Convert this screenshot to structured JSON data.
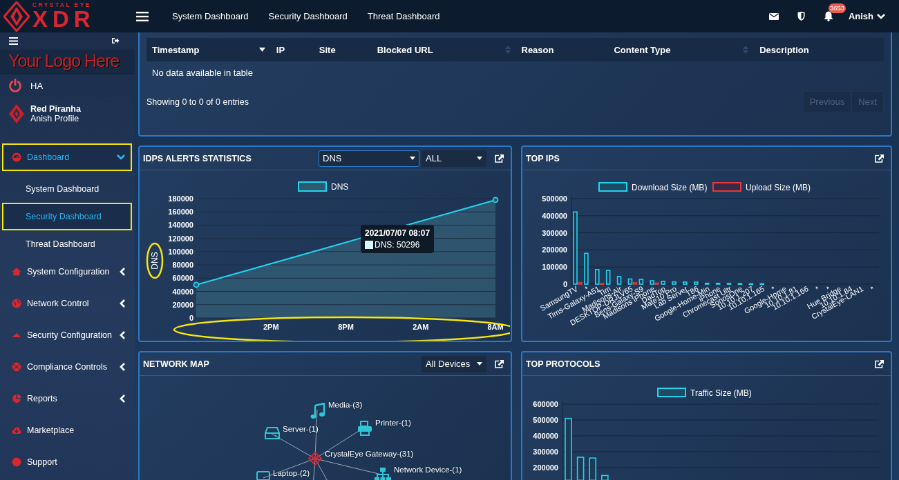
{
  "header": {
    "brand_top": "CRYSTAL EYE",
    "brand_main": "XDR",
    "nav": [
      {
        "label": "System Dashboard"
      },
      {
        "label": "Security Dashboard"
      },
      {
        "label": "Threat Dashboard"
      }
    ],
    "notifications": "3653",
    "user": "Anish"
  },
  "sidebar": {
    "logo_text": "Your Logo Here",
    "ha": "HA",
    "profile": {
      "name": "Red Piranha",
      "subtitle": "Anish Profile"
    },
    "menu": [
      {
        "label": "Dashboard",
        "kind": "group",
        "selected": true,
        "expanded": true,
        "highlighted": true,
        "children": [
          {
            "label": "System Dashboard",
            "selected": false,
            "highlighted": false
          },
          {
            "label": "Security Dashboard",
            "selected": true,
            "highlighted": true
          },
          {
            "label": "Threat Dashboard",
            "selected": false,
            "highlighted": false
          }
        ]
      },
      {
        "label": "System Configuration",
        "kind": "group",
        "selected": false,
        "expanded": false,
        "highlighted": false
      },
      {
        "label": "Network Control",
        "kind": "group",
        "selected": false,
        "expanded": false,
        "highlighted": false
      },
      {
        "label": "Security Configuration",
        "kind": "group",
        "selected": false,
        "expanded": false,
        "highlighted": false
      },
      {
        "label": "Compliance Controls",
        "kind": "group",
        "selected": false,
        "expanded": false,
        "highlighted": false
      },
      {
        "label": "Reports",
        "kind": "group",
        "selected": false,
        "expanded": false,
        "highlighted": false
      },
      {
        "label": "Marketplace",
        "kind": "link",
        "selected": false,
        "highlighted": false
      },
      {
        "label": "Support",
        "kind": "link",
        "selected": false,
        "highlighted": false
      }
    ]
  },
  "table": {
    "columns": [
      {
        "label": "Timestamp",
        "sortable": true,
        "sorted": true
      },
      {
        "label": "IP"
      },
      {
        "label": "Site"
      },
      {
        "label": "Blocked URL",
        "sortable": true,
        "sorted": false
      },
      {
        "label": "Reason"
      },
      {
        "label": "Content Type",
        "sortable": true,
        "sorted": false
      },
      {
        "label": "Description"
      }
    ],
    "empty_message": "No data available in table",
    "info": "Showing 0 to 0 of 0 entries",
    "pager": [
      {
        "label": "Previous",
        "disabled": true
      },
      {
        "label": "Next",
        "disabled": true
      }
    ]
  },
  "panels": [
    {
      "kind": "line_chart",
      "title": "IDPS ALERTS STATISTICS",
      "dropdowns": [
        {
          "value": "DNS",
          "focused": true
        },
        {
          "value": "ALL",
          "focused": false
        }
      ],
      "highlights": {
        "y_axis_label": true,
        "x_axis": true
      },
      "tooltip": {
        "title": "2021/07/07 08:07",
        "text": "DNS: 50296"
      },
      "chart_data": {
        "type": "area",
        "ylabel": "DNS",
        "legend": "top",
        "grid": true,
        "categories": [
          null,
          "2PM",
          "8PM",
          "2AM",
          "8AM"
        ],
        "ylim": [
          0,
          180000
        ],
        "yticks": [
          0,
          20000,
          40000,
          60000,
          80000,
          100000,
          120000,
          140000,
          160000,
          180000
        ],
        "series": [
          {
            "name": "DNS",
            "color": "#22d3ee",
            "values": [
              50000,
              82000,
              114000,
              146000,
              178000
            ]
          }
        ]
      }
    },
    {
      "kind": "bar_chart",
      "title": "TOP IPS",
      "chart_data": {
        "type": "bar",
        "legend": "top",
        "grid": true,
        "categories": [
          "SamsungTV",
          "*",
          "Tims-Galaxy-A51",
          "Tim",
          "Madisons-Air",
          "DESKTOP-DRJLV65",
          "Bens-Galaxy-S9",
          "Madisons iPhone",
          "DadTop",
          "Mate10 Pro",
          "Lab Server",
          "T86",
          "Google-Home-Min",
          "iPhone",
          "Chromecast Ultr",
          "SonosOne",
          "10.10.1.207",
          "10.10.1.165",
          "*",
          "Google-Home",
          "10.10.1.81",
          "10.10.1.166",
          "*",
          "*",
          "Hue Bridge",
          "10.10.1.84",
          "CrystalEye-LAN1",
          "*"
        ],
        "ylim": [
          0,
          500000
        ],
        "yticks": [
          0,
          100000,
          200000,
          300000,
          400000,
          500000
        ],
        "series": [
          {
            "name": "Download Size (MB)",
            "color": "#22d3ee",
            "values": [
              422000,
              180000,
              85000,
              80000,
              45000,
              30000,
              28000,
              20000,
              16000,
              13000,
              12000,
              12000,
              5000,
              5000,
              4000,
              3000,
              2000,
              2000,
              0,
              0,
              0,
              0,
              0,
              0,
              0,
              0,
              0,
              0
            ]
          },
          {
            "name": "Upload Size (MB)",
            "color": "#e53935",
            "values": [
              8000,
              0,
              3000,
              0,
              0,
              8000,
              0,
              6000,
              0,
              0,
              0,
              0,
              0,
              0,
              0,
              0,
              0,
              0,
              0,
              0,
              0,
              0,
              0,
              0,
              0,
              0,
              0,
              0
            ]
          }
        ]
      }
    },
    {
      "kind": "network_map",
      "title": "NETWORK MAP",
      "dropdowns": [
        {
          "value": "All Devices",
          "focused": false
        }
      ],
      "map": {
        "center": {
          "label": "CrystalEye Gateway-(31)"
        },
        "nodes": [
          {
            "label": "Media-(3)",
            "kind": "media"
          },
          {
            "label": "Printer-(1)",
            "kind": "printer"
          },
          {
            "label": "Server-(1)",
            "kind": "server"
          },
          {
            "label": "Network Device-(1)",
            "kind": "network"
          },
          {
            "label": "Laptop-(2)",
            "kind": "laptop"
          }
        ]
      }
    },
    {
      "kind": "bar_chart",
      "title": "TOP PROTOCOLS",
      "chart_data": {
        "type": "bar",
        "legend": "top",
        "grid": true,
        "categories": [
          null,
          null,
          null,
          null,
          null,
          null,
          null,
          null,
          null,
          null,
          null,
          null,
          null,
          null,
          null,
          null,
          null,
          null,
          null,
          null,
          null,
          null,
          null,
          null,
          null,
          null
        ],
        "ylim": [
          120000,
          600000
        ],
        "yticks": [
          200000,
          300000,
          400000,
          500000,
          600000
        ],
        "series": [
          {
            "name": "Traffic Size (MB)",
            "color": "#22d3ee",
            "values": [
              510000,
              265000,
              260000,
              150000,
              null,
              null,
              null,
              null,
              null,
              null,
              null,
              null,
              null,
              null,
              null,
              null,
              null,
              null,
              null,
              null,
              null,
              null,
              null,
              null,
              null,
              null
            ]
          }
        ]
      }
    }
  ]
}
